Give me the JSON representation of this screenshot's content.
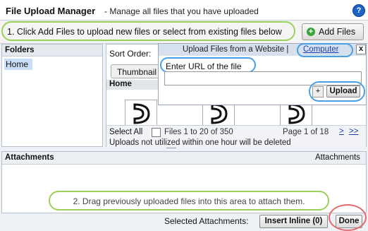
{
  "header": {
    "title": "File Upload Manager",
    "subtitle": "- Manage all files that you have uploaded",
    "help": "?"
  },
  "instructions": {
    "step1": "1. Click Add Files to upload new files or select from existing files below",
    "add_files": "Add Files",
    "add_icon": "+"
  },
  "folders": {
    "title": "Folders",
    "items": [
      "Home"
    ]
  },
  "browser": {
    "sort_label": "Sort Order:",
    "view_button": "Thumbnail",
    "current_folder": "Home",
    "select_all": "Select All",
    "files_range": "Files 1 to 20 of 350",
    "page_info": "Page 1 of 18",
    "next": ">",
    "last": ">>",
    "note": "Uploads not utilized within one hour will be deleted"
  },
  "popup": {
    "title": "Upload Files from a Website |",
    "computer_link": "Computer",
    "close": "x",
    "url_label": "Enter URL of the file",
    "url_value": "",
    "plus": "+",
    "upload": "Upload"
  },
  "attachments": {
    "title": "Attachments",
    "right_label": "Attachments",
    "drag_hint": "2. Drag previously uploaded files into this area to attach them."
  },
  "bottom": {
    "selected_label": "Selected Attachments:",
    "insert_inline": "Insert Inline (0)",
    "done": "Done"
  },
  "colors": {
    "green_highlight": "#9bd05b",
    "blue_highlight": "#4aa0e6",
    "red_highlight": "#e26a6a",
    "link": "#1a3fa8"
  }
}
